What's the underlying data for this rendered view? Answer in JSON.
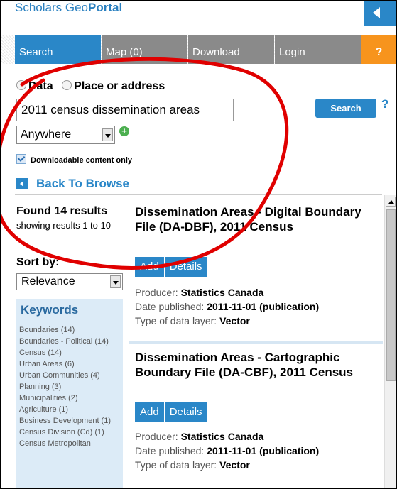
{
  "app": {
    "logo_part1": "Scholars Geo",
    "logo_part2": "Portal"
  },
  "nav": {
    "search": "Search",
    "map": "Map (0)",
    "download": "Download",
    "login": "Login",
    "help": "?"
  },
  "search": {
    "option_data": "Data",
    "option_place": "Place or address",
    "query": "2011 census dissemination areas",
    "button": "Search",
    "help": "?",
    "location": "Anywhere",
    "add_location": "+",
    "downloadable_only": "Downloadable content only",
    "back": "Back To Browse"
  },
  "results_summary": {
    "found": "Found 14 results",
    "showing": "showing results 1 to 10",
    "sort_label": "Sort by:",
    "sort_value": "Relevance"
  },
  "keywords": {
    "title": "Keywords",
    "items": [
      "Boundaries (14)",
      "Boundaries - Political (14)",
      "Census (14)",
      "Urban Areas (6)",
      "Urban Communities (4)",
      "Planning (3)",
      "Municipalities (2)",
      "Agriculture (1)",
      "Business Development (1)",
      "Census Division (Cd) (1)",
      "Census Metropolitan"
    ]
  },
  "results": [
    {
      "title": "Dissemination Areas - Digital Boundary File (DA-DBF), 2011 Census",
      "add": "Add",
      "details": "Details",
      "producer_label": "Producer: ",
      "producer": "Statistics Canada",
      "date_label": "Date published: ",
      "date": "2011-11-01 (publication)",
      "type_label": "Type of data layer: ",
      "type": "Vector"
    },
    {
      "title": "Dissemination Areas - Cartographic Boundary File (DA-CBF), 2011 Census",
      "add": "Add",
      "details": "Details",
      "producer_label": "Producer: ",
      "producer": "Statistics Canada",
      "date_label": "Date published: ",
      "date": "2011-11-01 (publication)",
      "type_label": "Type of data layer: ",
      "type": "Vector"
    }
  ],
  "colors": {
    "accent": "#2a87c8",
    "nav_inactive": "#8a8a8a",
    "help_tab": "#f7941d",
    "annotation": "#e00000"
  }
}
